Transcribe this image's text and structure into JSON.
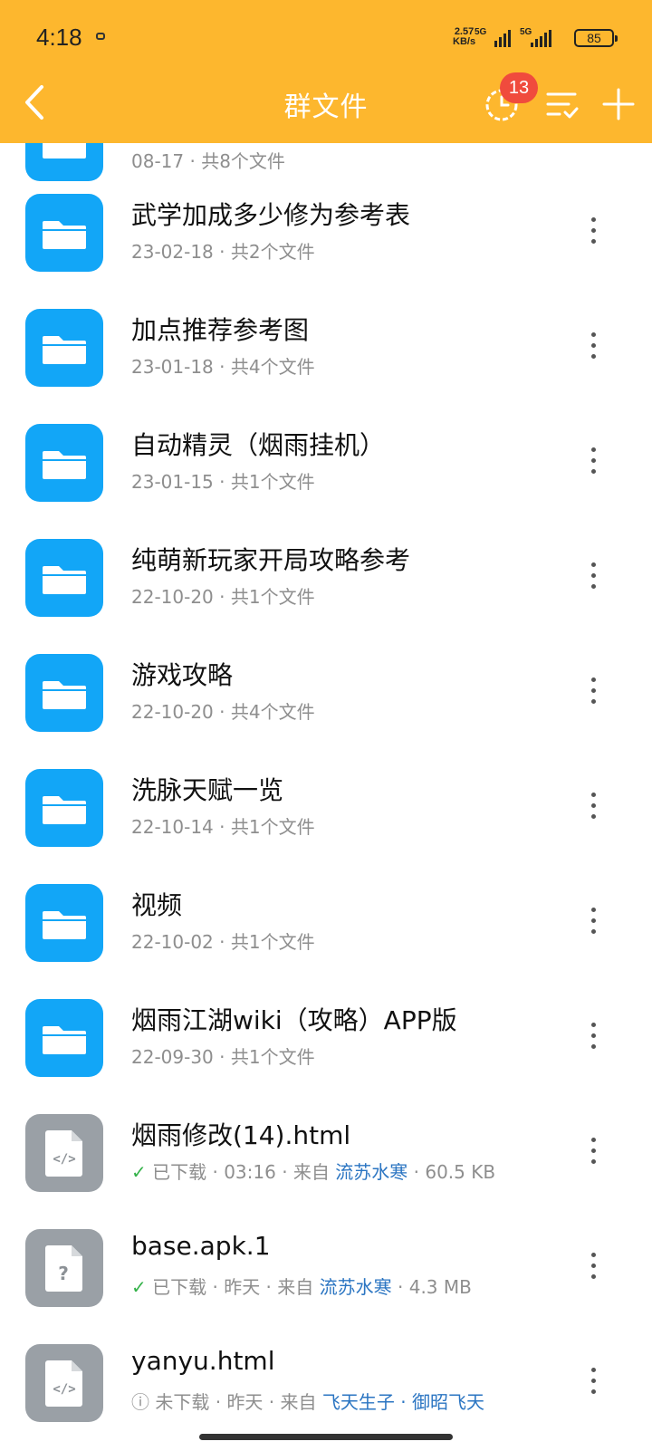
{
  "status_bar": {
    "time": "4:18",
    "speed_value": "2.57",
    "speed_unit": "KB/s",
    "sim1_label": "5G",
    "sim2_label": "5G",
    "battery": "85"
  },
  "header": {
    "title": "群文件",
    "badge_count": "13",
    "icons": [
      "back-arrow-icon",
      "history-clock-icon",
      "sort-icon",
      "add-icon"
    ],
    "color": "#fdb72e"
  },
  "files": [
    {
      "type": "folder",
      "name": "",
      "date": "08-17",
      "sep": " · ",
      "count": "共8个文件"
    },
    {
      "type": "folder",
      "name": "武学加成多少修为参考表",
      "date": "23-02-18",
      "sep": " · ",
      "count": "共2个文件"
    },
    {
      "type": "folder",
      "name": "加点推荐参考图",
      "date": "23-01-18",
      "sep": " · ",
      "count": "共4个文件"
    },
    {
      "type": "folder",
      "name": "自动精灵（烟雨挂机）",
      "date": "23-01-15",
      "sep": " · ",
      "count": "共1个文件"
    },
    {
      "type": "folder",
      "name": "纯萌新玩家开局攻略参考",
      "date": "22-10-20",
      "sep": " · ",
      "count": "共1个文件"
    },
    {
      "type": "folder",
      "name": "游戏攻略",
      "date": "22-10-20",
      "sep": " · ",
      "count": "共4个文件"
    },
    {
      "type": "folder",
      "name": "洗脉天赋一览",
      "date": "22-10-14",
      "sep": " · ",
      "count": "共1个文件"
    },
    {
      "type": "folder",
      "name": "视频",
      "date": "22-10-02",
      "sep": " · ",
      "count": "共1个文件"
    },
    {
      "type": "folder",
      "name": "烟雨江湖wiki（攻略）APP版",
      "date": "22-09-30",
      "sep": " · ",
      "count": "共1个文件"
    },
    {
      "type": "code-file",
      "name": "烟雨修改(14).html",
      "status_icon": "✓",
      "status": "已下载",
      "sep1": " · ",
      "time": "03:16",
      "sep2": " · ",
      "from": "来自 ",
      "sender": "流苏水寒",
      "sep3": " · ",
      "size": "60.5 KB"
    },
    {
      "type": "unknown-file",
      "name": "base.apk.1",
      "status_icon": "✓",
      "status": "已下载",
      "sep1": " · ",
      "time": "昨天",
      "sep2": " · ",
      "from": "来自 ",
      "sender": "流苏水寒",
      "sep3": " · ",
      "size": "4.3 MB"
    },
    {
      "type": "code-file",
      "name": "yanyu.html",
      "status_icon": "ⓘ",
      "status": "未下载",
      "sep1": " · ",
      "time": "昨天",
      "sep2": " · ",
      "from": "来自 ",
      "sender": "飞天生子 · 御昭飞天",
      "sep3": "",
      "size": ""
    }
  ]
}
